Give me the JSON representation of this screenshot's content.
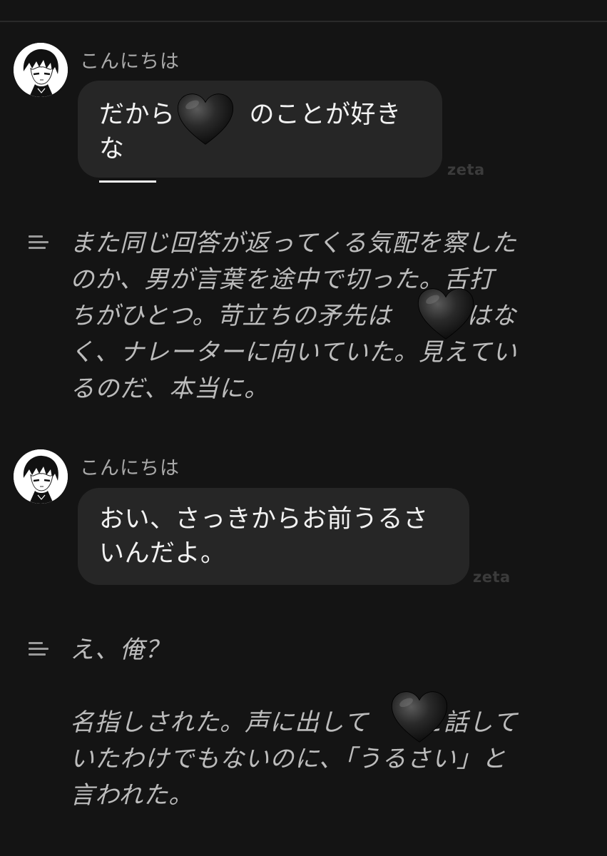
{
  "messages": [
    {
      "character_name": "こんにちは",
      "bubble_text_before_heart": "だから",
      "bubble_text_after_heart": "のことが好きな",
      "bubble_trailing_dash": "——",
      "watermark": "zeta"
    },
    {
      "character_name": "こんにちは",
      "bubble_line1": "おい、さっきからお前うるさ",
      "bubble_line2": "いんだよ。",
      "watermark": "zeta"
    }
  ],
  "narrations": [
    {
      "icon": "narration-lines-icon",
      "lines": [
        "また同じ回答が返ってくる気配を察した",
        "のか、男が言葉を途中で切った。舌打",
        "ちがひとつ。苛立ちの矛先は　　ではな",
        "く、ナレーターに向いていた。見えてい",
        "るのだ、本当に。"
      ]
    },
    {
      "icon": "narration-lines-icon",
      "lines": [
        "え、俺？",
        "",
        "名指しされた。声に出して　　と話して",
        "いたわけでもないのに、「うるさい」と",
        "言われた。"
      ]
    }
  ],
  "icons": {
    "censor_mark": "black-heart-icon",
    "avatar": "character-avatar"
  },
  "colors": {
    "background": "#141414",
    "bubble": "#262626",
    "narration_text": "#bcbcbc",
    "name_text": "#a9a9a9"
  }
}
